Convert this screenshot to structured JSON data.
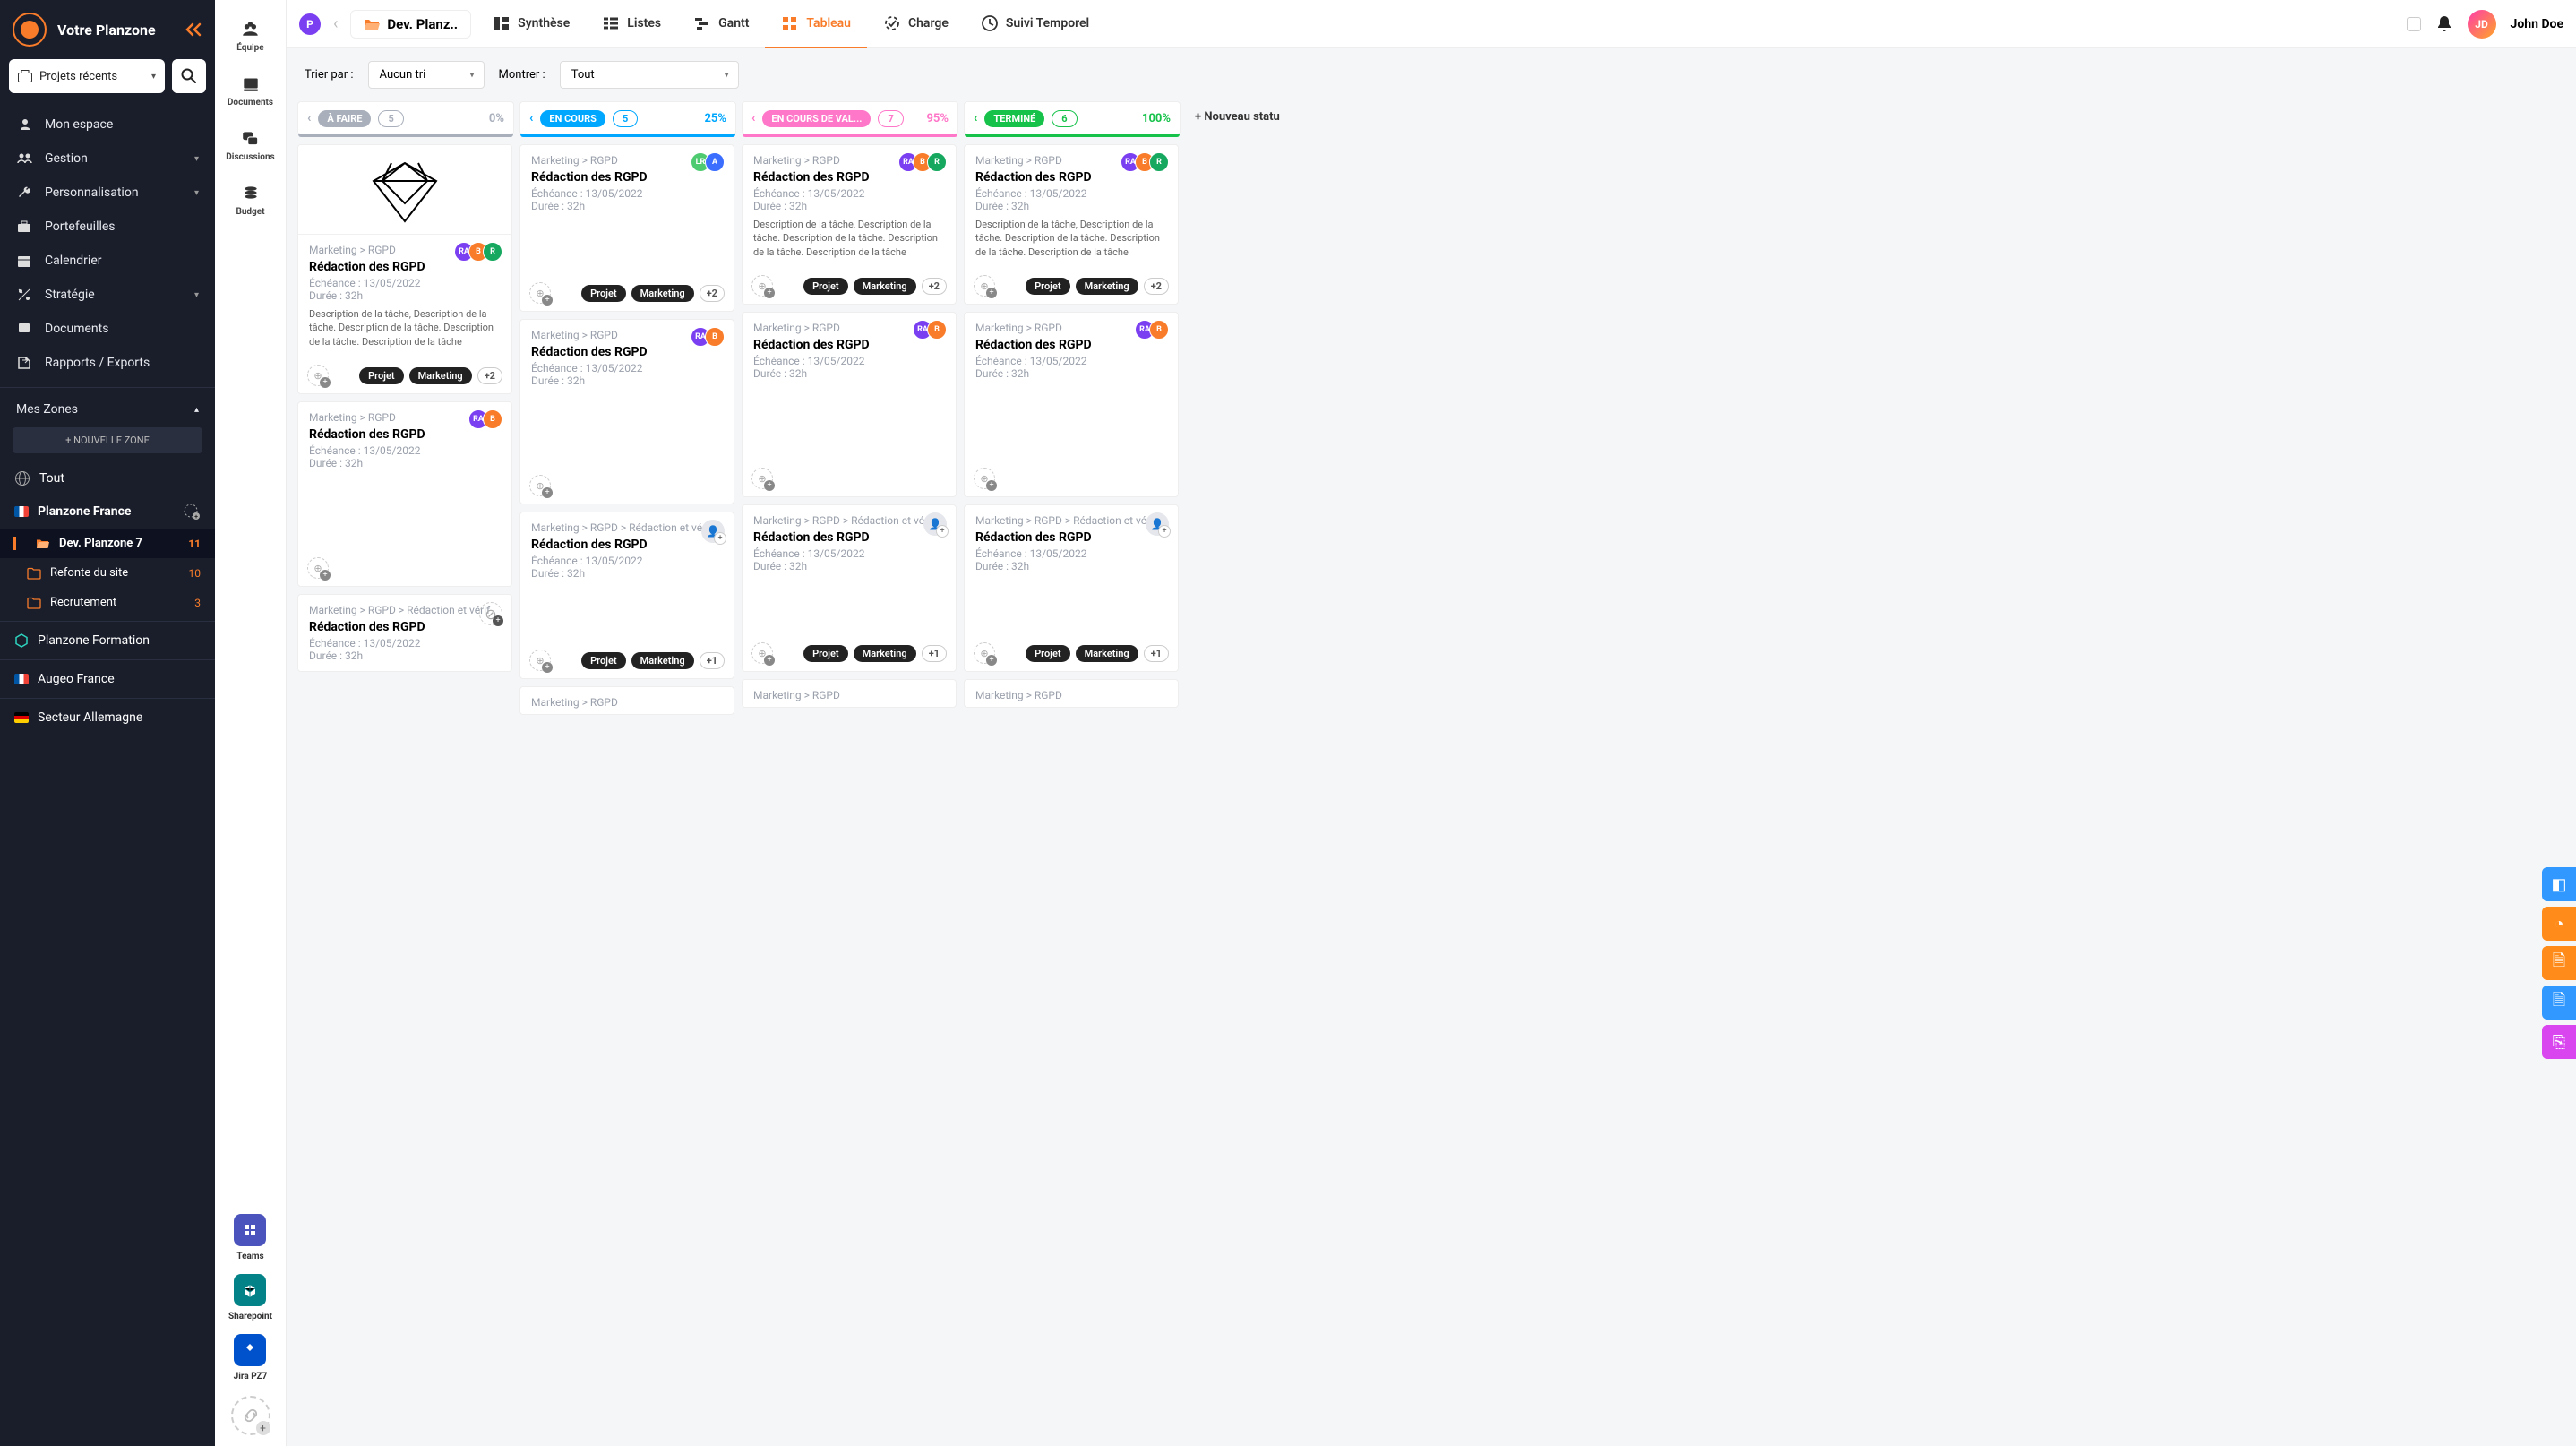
{
  "brand": "Votre Planzone",
  "recent_label": "Projets récents",
  "nav": [
    {
      "icon": "user-space",
      "label": "Mon espace"
    },
    {
      "icon": "users",
      "label": "Gestion",
      "chev": true
    },
    {
      "icon": "wrench",
      "label": "Personnalisation",
      "chev": true
    },
    {
      "icon": "briefcase",
      "label": "Portefeuilles"
    },
    {
      "icon": "calendar",
      "label": "Calendrier"
    },
    {
      "icon": "strategy",
      "label": "Stratégie",
      "chev": true
    },
    {
      "icon": "docs",
      "label": "Documents"
    },
    {
      "icon": "export",
      "label": "Rapports / Exports"
    }
  ],
  "zones_header": "Mes Zones",
  "new_zone": "+  NOUVELLE ZONE",
  "zones": {
    "all": "Tout",
    "france": {
      "label": "Planzone France"
    },
    "folders": [
      {
        "label": "Dev. Planzone 7",
        "count": "11",
        "active": true,
        "open": true
      },
      {
        "label": "Refonte du site",
        "count": "10"
      },
      {
        "label": "Recrutement",
        "count": "3"
      }
    ],
    "formation": "Planzone Formation",
    "augeo": "Augeo France",
    "allemagne": "Secteur Allemagne"
  },
  "inner_sidebar": [
    {
      "label": "Équipe",
      "ic": "team"
    },
    {
      "label": "Documents",
      "ic": "docs"
    },
    {
      "label": "Discussions",
      "ic": "chat"
    },
    {
      "label": "Budget",
      "ic": "budget"
    }
  ],
  "inner_apps": [
    {
      "label": "Teams"
    },
    {
      "label": "Sharepoint"
    },
    {
      "label": "Jira PZ7"
    }
  ],
  "breadcrumb": "Dev. Planz..",
  "tabs": [
    {
      "label": "Synthèse"
    },
    {
      "label": "Listes"
    },
    {
      "label": "Gantt"
    },
    {
      "label": "Tableau",
      "active": true
    },
    {
      "label": "Charge"
    },
    {
      "label": "Suivi Temporel"
    }
  ],
  "user": {
    "initials": "JD",
    "name": "John Doe"
  },
  "filters": {
    "sort_label": "Trier par :",
    "sort_value": "Aucun tri",
    "show_label": "Montrer :",
    "show_value": "Tout"
  },
  "columns": [
    {
      "name": "À FAIRE",
      "count": "5",
      "pct": "0%",
      "color": "#a9b0bc",
      "chev_color": "#a9b0bc",
      "pct_color": "#a9b0bc"
    },
    {
      "name": "EN COURS",
      "count": "5",
      "pct": "25%",
      "color": "#00a7ff",
      "chev_color": "#00a7ff",
      "pct_color": "#00a7ff"
    },
    {
      "name": "EN COURS DE VAL...",
      "count": "7",
      "pct": "95%",
      "color": "#ff77c8",
      "chev_color": "#ff77c8",
      "pct_color": "#ff77c8"
    },
    {
      "name": "TERMINÉ",
      "count": "6",
      "pct": "100%",
      "color": "#16c24a",
      "chev_color": "#16c24a",
      "pct_color": "#16c24a"
    }
  ],
  "new_status": "+ Nouveau statu",
  "card_common": {
    "breadcrumb_short": "Marketing > RGPD",
    "breadcrumb_long": "Marketing > RGPD > Rédaction et vérif",
    "title": "Rédaction des RGPD",
    "echeance": "Échéance : 13/05/2022",
    "duree": "Durée : 32h",
    "desc": "Description de la tâche, Description de la tâche. Description de la tâche. Description de la tâche. Description de la tâche",
    "tag1": "Projet",
    "tag2": "Marketing",
    "plus2": "+2",
    "plus1": "+1"
  },
  "av_colors": {
    "RA": "#7b3ff2",
    "B": "#f87c2a",
    "R": "#16a85f",
    "LR": "#4ecb71",
    "A": "#3b6eff"
  }
}
